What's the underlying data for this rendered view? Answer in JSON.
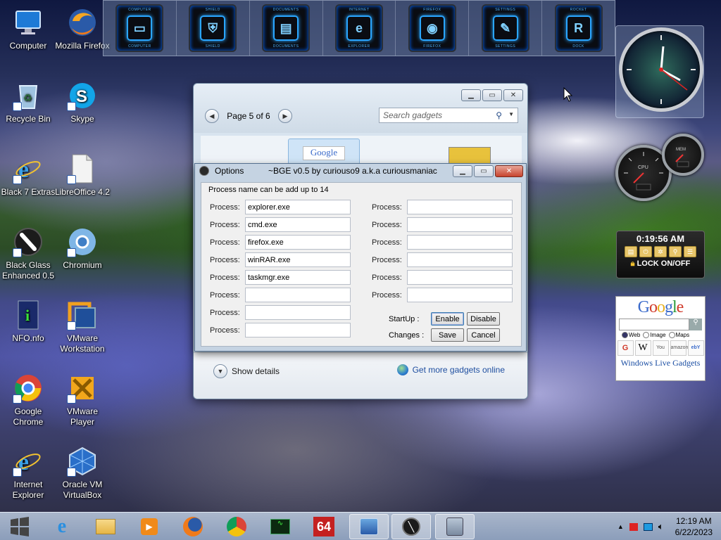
{
  "desktop": {
    "icons": [
      {
        "label": "Computer",
        "icon": "computer-icon"
      },
      {
        "label": "Mozilla Firefox",
        "icon": "firefox-icon"
      },
      {
        "label": "Recycle Bin",
        "icon": "recycle-bin-icon"
      },
      {
        "label": "Skype",
        "icon": "skype-icon"
      },
      {
        "label": "Black 7 Extras",
        "icon": "internet-explorer-icon"
      },
      {
        "label": "LibreOffice 4.2",
        "icon": "document-icon"
      },
      {
        "label": "Black Glass Enhanced 0.5",
        "icon": "black-glass-icon"
      },
      {
        "label": "Chromium",
        "icon": "chromium-icon"
      },
      {
        "label": "NFO.nfo",
        "icon": "info-file-icon"
      },
      {
        "label": "VMware Workstation",
        "icon": "vmware-icon"
      },
      {
        "label": "Google Chrome",
        "icon": "chrome-icon"
      },
      {
        "label": "VMware Player",
        "icon": "vmware-player-icon"
      },
      {
        "label": "Internet Explorer",
        "icon": "internet-explorer-icon"
      },
      {
        "label": "Oracle VM VirtualBox",
        "icon": "virtualbox-icon"
      }
    ]
  },
  "dock": {
    "items": [
      {
        "top": "COMPUTER",
        "bottom": "COMPUTER",
        "glyph": "▭"
      },
      {
        "top": "SHIELD",
        "bottom": "SHIELD",
        "glyph": "⛨"
      },
      {
        "top": "DOCUMENTS",
        "bottom": "DOCUMENTS",
        "glyph": "▤"
      },
      {
        "top": "INTERNET",
        "bottom": "EXPLORER",
        "glyph": "e"
      },
      {
        "top": "FIREFOX",
        "bottom": "FIREFOX",
        "glyph": "◉"
      },
      {
        "top": "SETTINGS",
        "bottom": "SETTINGS",
        "glyph": "✎"
      },
      {
        "top": "ROCKET",
        "bottom": "DOCK",
        "glyph": "R"
      }
    ]
  },
  "gadgets_window": {
    "pager": {
      "label": "Page 5 of 6"
    },
    "search": {
      "placeholder": "Search gadgets"
    },
    "thumb_label": "Google",
    "footer": {
      "show_details": "Show details",
      "more": "Get more gadgets online"
    }
  },
  "options_dialog": {
    "title": "Options",
    "subtitle": "~BGE v0.5 by curiouso9 a.k.a curiousmaniac",
    "group_title": "Process name can be add up to 14",
    "process_label": "Process:",
    "left_processes": [
      "explorer.exe",
      "cmd.exe",
      "firefox.exe",
      "winRAR.exe",
      "taskmgr.exe",
      "",
      "",
      ""
    ],
    "right_processes": [
      "",
      "",
      "",
      "",
      "",
      ""
    ],
    "startup_label": "StartUp  :",
    "changes_label": "Changes :",
    "enable": "Enable",
    "disable": "Disable",
    "save": "Save",
    "cancel": "Cancel"
  },
  "widgets": {
    "lock": {
      "time": "0:19:56 AM",
      "label": "LOCK ON/OFF"
    },
    "google": {
      "logo": "Google",
      "radios": [
        "Web",
        "Image",
        "Maps"
      ],
      "tiles": [
        "G",
        "W",
        "You",
        "amazon",
        "ebY"
      ],
      "footer": "Windows Live Gadgets"
    },
    "gauges": {
      "cpu": "CPU",
      "mem": "MEM"
    }
  },
  "taskbar": {
    "clock_time": "12:19 AM",
    "clock_date": "6/22/2023",
    "app_64": "64"
  },
  "colors": {
    "accent": "#1f4fa0",
    "dock_glow": "#2aa6ff"
  }
}
